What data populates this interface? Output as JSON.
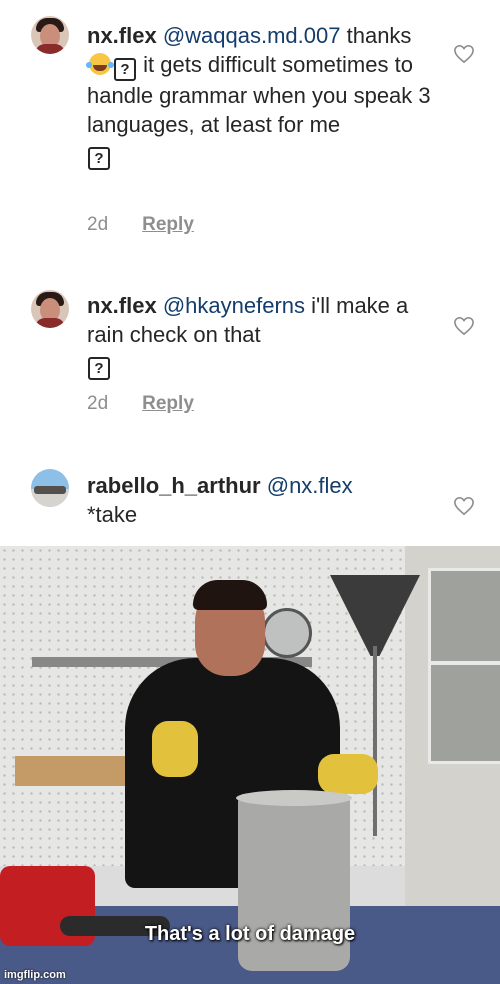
{
  "comments": [
    {
      "username": "nx.flex",
      "mention": "@waqqas.md.007",
      "body_parts": [
        "thanks",
        "it gets difficult sometimes to handle grammar when you speak 3 languages, at least for me"
      ],
      "time": "2d",
      "reply_label": "Reply"
    },
    {
      "username": "nx.flex",
      "mention": "@hkayneferns",
      "body_parts": [
        "i'll make a rain check on that"
      ],
      "time": "2d",
      "reply_label": "Reply"
    },
    {
      "username": "rabello_h_arthur",
      "mention": "@nx.flex",
      "body_parts": [
        "*take"
      ]
    }
  ],
  "qbox_glyph": "?",
  "meme": {
    "caption": "That's a lot of damage",
    "watermark": "imgflip.com"
  },
  "icons": {
    "like": "heart-outline-icon",
    "emoji": "laughing-crying-emoji-icon",
    "unknown_glyph": "question-box-icon"
  },
  "colors": {
    "mention": "#143d6b",
    "meta": "#8e8e8e"
  }
}
